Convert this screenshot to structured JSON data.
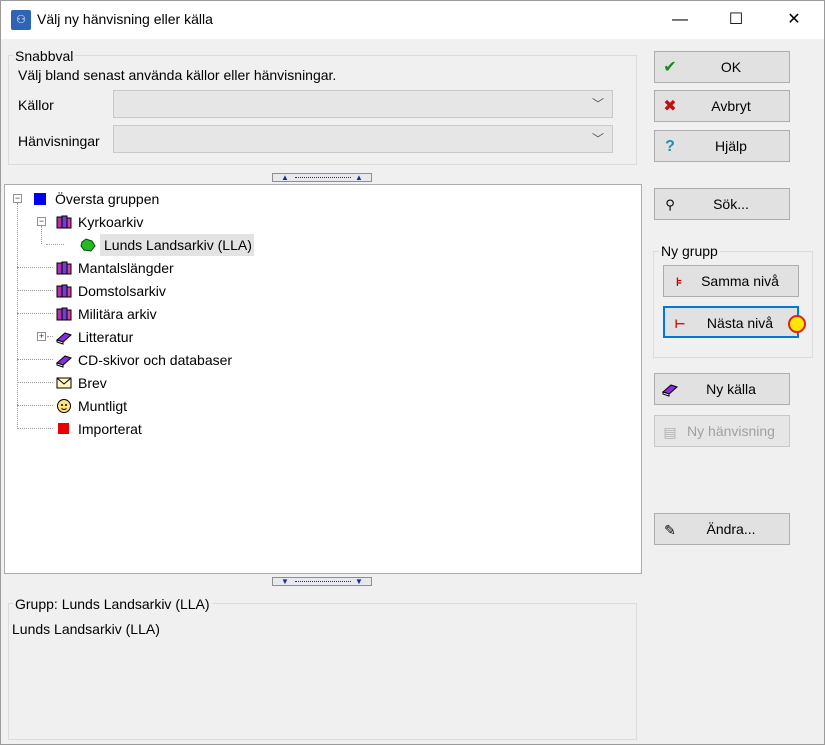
{
  "window": {
    "title": "Välj ny hänvisning eller källa",
    "minimize": "—",
    "maximize": "☐",
    "close": "✕"
  },
  "snabbval": {
    "legend": "Snabbval",
    "description": "Välj bland senast använda källor eller hänvisningar.",
    "kallor_label": "Källor",
    "kallor_value": "",
    "hanvisningar_label": "Hänvisningar",
    "hanvisningar_value": ""
  },
  "tree": {
    "items": [
      {
        "label": "Översta gruppen",
        "icon": "blue-square-icon"
      },
      {
        "label": "Kyrkoarkiv",
        "icon": "books-icon"
      },
      {
        "label": "Lunds Landsarkiv (LLA)",
        "icon": "green-folder-icon"
      },
      {
        "label": "Mantalslängder",
        "icon": "books-icon"
      },
      {
        "label": "Domstolsarkiv",
        "icon": "books-icon"
      },
      {
        "label": "Militära arkiv",
        "icon": "books-icon"
      },
      {
        "label": "Litteratur",
        "icon": "book-icon"
      },
      {
        "label": "CD-skivor och databaser",
        "icon": "book-icon"
      },
      {
        "label": "Brev",
        "icon": "envelope-icon"
      },
      {
        "label": "Muntligt",
        "icon": "face-icon"
      },
      {
        "label": "Importerat",
        "icon": "red-square-icon"
      }
    ]
  },
  "info": {
    "legend": "Grupp: Lunds Landsarkiv (LLA)",
    "text": "Lunds Landsarkiv (LLA)"
  },
  "buttons": {
    "ok": "OK",
    "avbryt": "Avbryt",
    "hjalp": "Hjälp",
    "sok": "Sök...",
    "ny_grupp_legend": "Ny grupp",
    "samma_niva": "Samma nivå",
    "nasta_niva": "Nästa nivå",
    "ny_kalla": "Ny källa",
    "ny_hanvisning": "Ny hänvisning",
    "andra": "Ändra..."
  },
  "colors": {
    "accent": "#0078d7",
    "selection": "#e3e3e3"
  }
}
